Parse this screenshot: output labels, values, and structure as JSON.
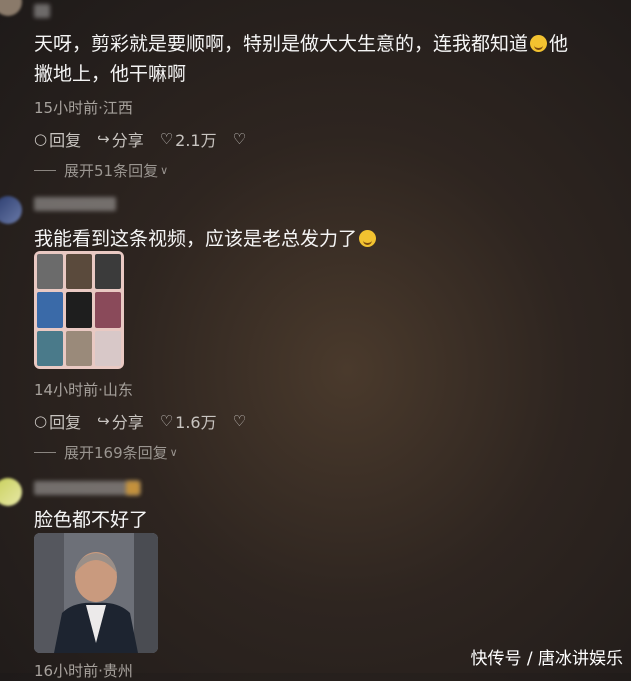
{
  "comments": [
    {
      "text_line1": "天呀，剪彩就是要顺啊，特别是做大大生意的，连我都知道",
      "text_line1_tail": "他",
      "text_line2": "撇地上，他干嘛啊",
      "meta": "15小时前·江西",
      "reply": "回复",
      "share": "分享",
      "likes": "2.1万",
      "expand": "展开51条回复"
    },
    {
      "text": "我能看到这条视频，应该是老总发力了",
      "meta": "14小时前·山东",
      "reply": "回复",
      "share": "分享",
      "likes": "1.6万",
      "expand": "展开169条回复"
    },
    {
      "text": "脸色都不好了",
      "meta": "16小时前·贵州"
    }
  ],
  "watermark": "快传号 / 唐冰讲娱乐",
  "icons": {
    "reply": "comment-bubble-icon",
    "share": "share-arrow-icon",
    "like": "heart-icon",
    "dislike": "broken-heart-icon",
    "expand": "chevron-down-icon"
  }
}
